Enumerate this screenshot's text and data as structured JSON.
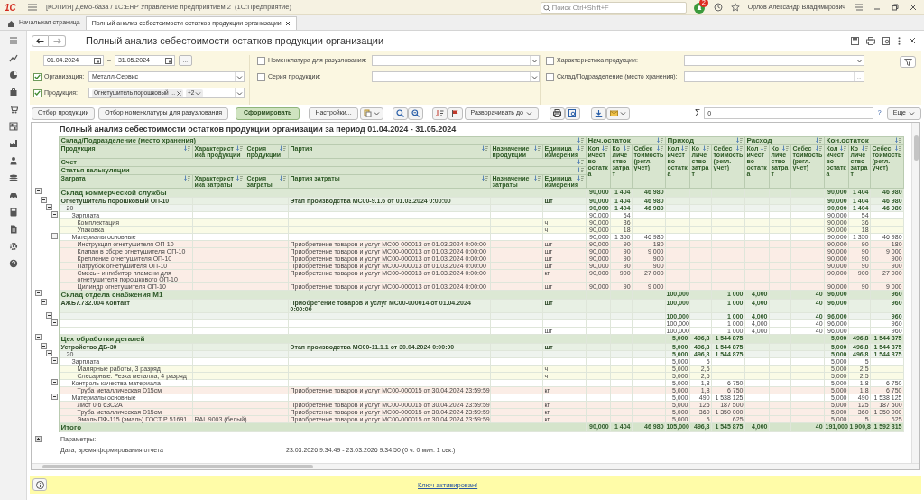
{
  "app": {
    "logo": "1С",
    "title": "[КОПИЯ] Демо-база / 1С:ERP Управление предприятием 2  (1С:Предприятие)",
    "search": {
      "placeholder": "Поиск Ctrl+Shift+F"
    },
    "notifications": "2",
    "user": "Орлов Александр Владимирович"
  },
  "tabs": [
    {
      "label": "Начальная страница",
      "selected": false
    },
    {
      "label": "Полный анализ себестоимости остатков продукции организации",
      "selected": true
    }
  ],
  "form": {
    "title": "Полный анализ себестоимости остатков продукции организации"
  },
  "filters": {
    "period": {
      "from": "01.04.2024",
      "separator": "–",
      "to": "31.05.2024",
      "button": "..."
    },
    "left": [
      {
        "label": "Организация:",
        "checked": true,
        "value": "Металл-Сервис",
        "button": {
          "kind": "dropdown"
        }
      },
      {
        "label": "Продукция:",
        "checked": true,
        "tags": [
          {
            "label": "Огнетушитель порошковый ..."
          }
        ],
        "more": "+2",
        "button": {
          "kind": "dropdown"
        }
      }
    ],
    "middle": [
      {
        "label": "Номенклатура для разузлования:",
        "checked": false,
        "button": {
          "kind": "dropdown"
        }
      },
      {
        "label": "Серия продукции:",
        "checked": false,
        "button": {
          "kind": "dropdown"
        }
      }
    ],
    "right": [
      {
        "label": "Характеристика продукции:",
        "checked": false,
        "button": {
          "kind": "dropdown"
        }
      },
      {
        "label": "Склад/Подразделение (место хранения):",
        "checked": false,
        "button": {
          "kind": "select",
          "label": "..."
        }
      }
    ]
  },
  "toolbar": {
    "buttons": [
      {
        "label": "Отбор продукции",
        "default": false
      },
      {
        "label": "Отбор номенклатуры для разузлования",
        "default": false
      },
      {
        "label": "Сформировать",
        "default": true
      }
    ],
    "settings": "Настройки...",
    "expand": "Разворачивать до",
    "sum_sign": "Σ",
    "sum": "0",
    "help": "?",
    "more": "Еще"
  },
  "report": {
    "title": "Полный анализ себестоимости остатков продукции организации за период 01.04.2024 - 31.05.2024",
    "header": {
      "storage": "Склад/Подразделение (место хранения)",
      "product_columns": [
        "Продукция",
        "Характеристика продукции",
        "Серия продукции",
        "Партия",
        "Назначение продукции",
        "Единица измерения"
      ],
      "account": "Счет",
      "article": "Статья калькуляции",
      "cost_columns": [
        "Затрата",
        "Характеристика затраты",
        "Серия затраты",
        "Партия затраты",
        "Назначение затраты",
        "Единица измерения"
      ],
      "groups": [
        "Нач.остаток",
        "Приход",
        "Расход",
        "Кон.остаток"
      ],
      "value_columns": [
        "Количество остатка",
        "Количество затрат",
        "Себестоимость (регл. учет)",
        "Количество остатка",
        "Количество затрат",
        "Себестоимость (регл. учет)",
        "Количество остатка",
        "Количество затрат",
        "Себестоимость (регл. учет)",
        "Количество остатка",
        "Количество затрат",
        "Себестоимость (регл. учет)"
      ]
    },
    "rows": [
      {
        "kind": "warehouse",
        "label": "Склад коммерческой службы",
        "expanded": true,
        "values": {
          "opening_qty": "90,000",
          "opening_cost_qty": "1 404",
          "opening_cost": "46 980",
          "closing_qty": "90,000",
          "closing_cost_qty": "1 404",
          "closing_cost": "46 980"
        },
        "children": [
          {
            "kind": "product",
            "label": "Огнетушитель порошковый ОП-10",
            "batch": "Этап производства МС00-9.1.6 от 01.03.2024 0:00:00",
            "unit": "шт",
            "expanded": true,
            "values": {
              "opening_qty": "90,000",
              "opening_cost_qty": "1 404",
              "opening_cost": "46 980",
              "closing_qty": "90,000",
              "closing_cost_qty": "1 404",
              "closing_cost": "46 980"
            },
            "children": [
              {
                "kind": "account",
                "label": "20",
                "expanded": true,
                "values": {
                  "opening_qty": "90,000",
                  "opening_cost_qty": "1 404",
                  "opening_cost": "46 980",
                  "closing_qty": "90,000",
                  "closing_cost_qty": "1 404",
                  "closing_cost": "46 980"
                },
                "children": [
                  {
                    "kind": "article",
                    "label": "Зарплата",
                    "expanded": true,
                    "values": {
                      "opening_qty": "90,000",
                      "opening_cost_qty": "54",
                      "closing_qty": "90,000",
                      "closing_cost_qty": "54"
                    },
                    "children": [
                      {
                        "kind": "labor",
                        "label": "Комплектация",
                        "unit": "ч",
                        "values": {
                          "opening_qty": "90,000",
                          "opening_cost_qty": "36",
                          "closing_qty": "90,000",
                          "closing_cost_qty": "36"
                        }
                      },
                      {
                        "kind": "labor",
                        "label": "Упаковка",
                        "unit": "ч",
                        "values": {
                          "opening_qty": "90,000",
                          "opening_cost_qty": "18",
                          "closing_qty": "90,000",
                          "closing_cost_qty": "18"
                        }
                      }
                    ]
                  },
                  {
                    "kind": "article",
                    "label": "Материалы основные",
                    "expanded": true,
                    "values": {
                      "opening_qty": "90,000",
                      "opening_cost_qty": "1 350",
                      "opening_cost": "46 980",
                      "closing_qty": "90,000",
                      "closing_cost_qty": "1 350",
                      "closing_cost": "46 980"
                    },
                    "children": [
                      {
                        "kind": "material",
                        "label": "Инструкция огнетушителя ОП-10",
                        "batch": "Приобретение товаров и услуг МС00-000013 от 01.03.2024 0:00:00",
                        "unit": "шт",
                        "values": {
                          "opening_qty": "90,000",
                          "opening_cost_qty": "90",
                          "opening_cost": "180",
                          "closing_qty": "90,000",
                          "closing_cost_qty": "90",
                          "closing_cost": "180"
                        }
                      },
                      {
                        "kind": "material",
                        "label": "Клапан в сборе огнетушителя ОП-10",
                        "batch": "Приобретение товаров и услуг МС00-000013 от 01.03.2024 0:00:00",
                        "unit": "шт",
                        "values": {
                          "opening_qty": "90,000",
                          "opening_cost_qty": "90",
                          "opening_cost": "9 000",
                          "closing_qty": "90,000",
                          "closing_cost_qty": "90",
                          "closing_cost": "9 000"
                        }
                      },
                      {
                        "kind": "material",
                        "label": "Крепление огнетушителя ОП-10",
                        "batch": "Приобретение товаров и услуг МС00-000013 от 01.03.2024 0:00:00",
                        "unit": "шт",
                        "values": {
                          "opening_qty": "90,000",
                          "opening_cost_qty": "90",
                          "opening_cost": "900",
                          "closing_qty": "90,000",
                          "closing_cost_qty": "90",
                          "closing_cost": "900"
                        }
                      },
                      {
                        "kind": "material",
                        "label": "Патрубок огнетушителя ОП-10",
                        "batch": "Приобретение товаров и услуг МС00-000013 от 01.03.2024 0:00:00",
                        "unit": "шт",
                        "values": {
                          "opening_qty": "90,000",
                          "opening_cost_qty": "90",
                          "opening_cost": "900",
                          "closing_qty": "90,000",
                          "closing_cost_qty": "90",
                          "closing_cost": "900"
                        }
                      },
                      {
                        "kind": "material",
                        "label": "Смесь - ингибитор пламени для огнетушителя порошкового ОП-10",
                        "batch": "Приобретение товаров и услуг МС00-000013 от 01.03.2024 0:00:00",
                        "unit": "кг",
                        "values": {
                          "opening_qty": "90,000",
                          "opening_cost_qty": "900",
                          "opening_cost": "27 000",
                          "closing_qty": "90,000",
                          "closing_cost_qty": "900",
                          "closing_cost": "27 000"
                        }
                      },
                      {
                        "kind": "material",
                        "label": "Цилиндр огнетушителя ОП-10",
                        "batch": "Приобретение товаров и услуг МС00-000013 от 01.03.2024 0:00:00",
                        "unit": "шт",
                        "values": {
                          "opening_qty": "90,000",
                          "opening_cost_qty": "90",
                          "opening_cost": "9 000",
                          "closing_qty": "90,000",
                          "closing_cost_qty": "90",
                          "closing_cost": "9 000"
                        }
                      }
                    ]
                  }
                ]
              }
            ]
          }
        ]
      },
      {
        "kind": "warehouse",
        "label": "Склад отдела снабжения М1",
        "expanded": true,
        "values": {
          "receipt_qty": "100,000",
          "receipt_cost": "1 000",
          "issue_qty": "4,000",
          "issue_cost": "40",
          "closing_qty": "96,000",
          "closing_cost": "960"
        },
        "children": [
          {
            "kind": "product",
            "label": "АЖБ7.732.004 Контакт",
            "batch": "Приобретение товаров и услуг МС00-000014 от 01.04.2024 0:00:00",
            "unit": "шт",
            "expanded": true,
            "values": {
              "receipt_qty": "100,000",
              "receipt_cost": "1 000",
              "issue_qty": "4,000",
              "issue_cost": "40",
              "closing_qty": "96,000",
              "closing_cost": "960"
            },
            "children": [
              {
                "kind": "account",
                "expanded": true,
                "values": {
                  "receipt_qty": "100,000",
                  "receipt_cost": "1 000",
                  "issue_qty": "4,000",
                  "issue_cost": "40",
                  "closing_qty": "96,000",
                  "closing_cost": "960"
                },
                "children": [
                  {
                    "kind": "article",
                    "expanded": true,
                    "values": {
                      "receipt_qty": "100,000",
                      "receipt_cost": "1 000",
                      "issue_qty": "4,000",
                      "issue_cost": "40",
                      "closing_qty": "96,000",
                      "closing_cost": "960"
                    },
                    "children": [
                      {
                        "kind": "item",
                        "unit": "шт",
                        "values": {
                          "receipt_qty": "100,000",
                          "receipt_cost": "1 000",
                          "issue_qty": "4,000",
                          "issue_cost": "40",
                          "closing_qty": "96,000",
                          "closing_cost": "960"
                        }
                      }
                    ]
                  }
                ]
              }
            ]
          }
        ]
      },
      {
        "kind": "warehouse",
        "label": "Цех обработки деталей",
        "expanded": true,
        "values": {
          "receipt_qty": "5,000",
          "receipt_cost_qty": "496,8",
          "receipt_cost": "1 544 875",
          "closing_qty": "5,000",
          "closing_cost_qty": "496,8",
          "closing_cost": "1 544 875"
        },
        "children": [
          {
            "kind": "product",
            "label": "Устройство ДБ-30",
            "batch": "Этап производства МС00-11.1.1 от 30.04.2024 0:00:00",
            "unit": "шт",
            "expanded": true,
            "values": {
              "receipt_qty": "5,000",
              "receipt_cost_qty": "496,8",
              "receipt_cost": "1 544 875",
              "closing_qty": "5,000",
              "closing_cost_qty": "496,8",
              "closing_cost": "1 544 875"
            },
            "children": [
              {
                "kind": "account",
                "label": "20",
                "expanded": true,
                "values": {
                  "receipt_qty": "5,000",
                  "receipt_cost_qty": "496,8",
                  "receipt_cost": "1 544 875",
                  "closing_qty": "5,000",
                  "closing_cost_qty": "496,8",
                  "closing_cost": "1 544 875"
                },
                "children": [
                  {
                    "kind": "article",
                    "label": "Зарплата",
                    "expanded": true,
                    "values": {
                      "receipt_qty": "5,000",
                      "receipt_cost_qty": "5",
                      "closing_qty": "5,000",
                      "closing_cost_qty": "5"
                    },
                    "children": [
                      {
                        "kind": "labor",
                        "label": "Малярные работы, 3 разряд",
                        "unit": "ч",
                        "values": {
                          "receipt_qty": "5,000",
                          "receipt_cost_qty": "2,5",
                          "closing_qty": "5,000",
                          "closing_cost_qty": "2,5"
                        }
                      },
                      {
                        "kind": "labor",
                        "label": "Слесарные: Резка металла, 4 разряд",
                        "unit": "ч",
                        "values": {
                          "receipt_qty": "5,000",
                          "receipt_cost_qty": "2,5",
                          "closing_qty": "5,000",
                          "closing_cost_qty": "2,5"
                        }
                      }
                    ]
                  },
                  {
                    "kind": "article",
                    "label": "Контроль качества материала",
                    "expanded": true,
                    "values": {
                      "receipt_qty": "5,000",
                      "receipt_cost_qty": "1,8",
                      "receipt_cost": "6 750",
                      "closing_qty": "5,000",
                      "closing_cost_qty": "1,8",
                      "closing_cost": "6 750"
                    },
                    "children": [
                      {
                        "kind": "material",
                        "label": "Труба металлическая D15см",
                        "batch": "Приобретение товаров и услуг МС00-000015 от 30.04.2024 23:59:59",
                        "unit": "кг",
                        "values": {
                          "receipt_qty": "5,000",
                          "receipt_cost_qty": "1,8",
                          "receipt_cost": "6 750",
                          "closing_qty": "5,000",
                          "closing_cost_qty": "1,8",
                          "closing_cost": "6 750"
                        }
                      }
                    ]
                  },
                  {
                    "kind": "article",
                    "label": "Материалы основные",
                    "expanded": true,
                    "values": {
                      "receipt_qty": "5,000",
                      "receipt_cost_qty": "490",
                      "receipt_cost": "1 538 125",
                      "closing_qty": "5,000",
                      "closing_cost_qty": "490",
                      "closing_cost": "1 538 125"
                    },
                    "children": [
                      {
                        "kind": "material",
                        "label": "Лист 0,6 63С2А",
                        "batch": "Приобретение товаров и услуг МС00-000015 от 30.04.2024 23:59:59",
                        "unit": "кг",
                        "values": {
                          "receipt_qty": "5,000",
                          "receipt_cost_qty": "125",
                          "receipt_cost": "187 500",
                          "closing_qty": "5,000",
                          "closing_cost_qty": "125",
                          "closing_cost": "187 500"
                        }
                      },
                      {
                        "kind": "material",
                        "label": "Труба металлическая D15см",
                        "batch": "Приобретение товаров и услуг МС00-000015 от 30.04.2024 23:59:59",
                        "unit": "кг",
                        "values": {
                          "receipt_qty": "5,000",
                          "receipt_cost_qty": "360",
                          "receipt_cost": "1 350 000",
                          "closing_qty": "5,000",
                          "closing_cost_qty": "360",
                          "closing_cost": "1 350 000"
                        }
                      },
                      {
                        "kind": "material",
                        "label": "Эмаль ПФ-115 (эмаль) ГОСТ Р 51691",
                        "characteristic": "RAL 9003 (белый)",
                        "batch": "Приобретение товаров и услуг МС00-000015 от 30.04.2024 23:59:59",
                        "unit": "кг",
                        "values": {
                          "receipt_qty": "5,000",
                          "receipt_cost_qty": "5",
                          "receipt_cost": "625",
                          "closing_qty": "5,000",
                          "closing_cost_qty": "5",
                          "closing_cost": "625"
                        }
                      }
                    ]
                  }
                ]
              }
            ]
          }
        ]
      },
      {
        "kind": "total",
        "label": "Итого",
        "values": {
          "opening_qty": "90,000",
          "opening_cost_qty": "1 404",
          "opening_cost": "46 980",
          "receipt_qty": "105,000",
          "receipt_cost_qty": "496,8",
          "receipt_cost": "1 545 875",
          "issue_qty": "4,000",
          "issue_cost": "40",
          "closing_qty": "191,000",
          "closing_cost_qty": "1 900,8",
          "closing_cost": "1 592 815"
        }
      }
    ],
    "parameters": {
      "label": "Параметры:",
      "expanded": false
    },
    "generated": {
      "label": "Дата, время формирования отчета",
      "value": "23.03.2026 9:34:49 - 23.03.2026 9:34:50 (0 ч. 0 мин. 1 сек.)"
    }
  },
  "notice": {
    "link": "Ключ активирован!"
  }
}
